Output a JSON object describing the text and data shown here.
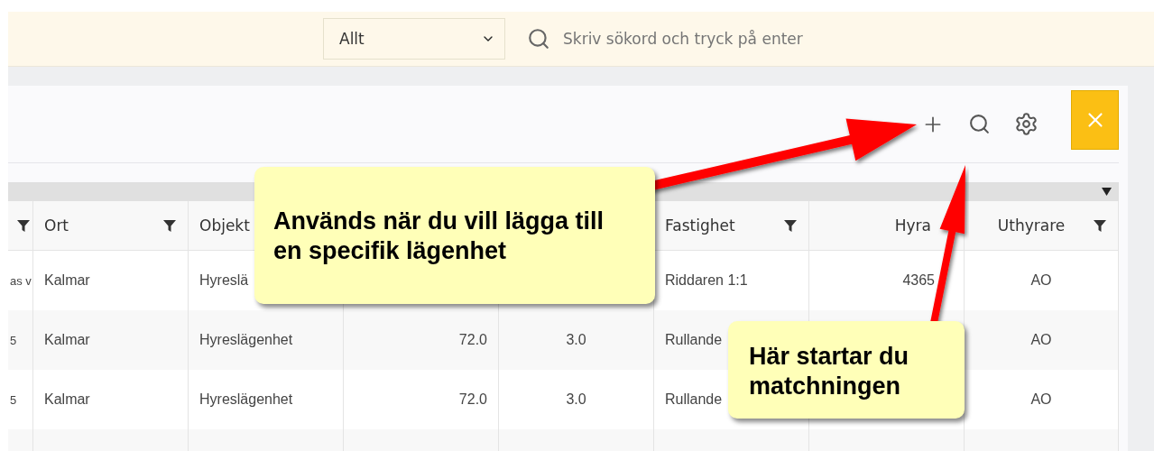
{
  "top_bar": {
    "filter_select": {
      "value": "Allt"
    },
    "search": {
      "placeholder": "Skriv sökord och tryck på enter"
    }
  },
  "table": {
    "columns": [
      {
        "filter": true
      },
      {
        "label": "Ort",
        "filter": true
      },
      {
        "label": "Objekt"
      },
      {},
      {},
      {
        "label": "Fastighet",
        "filter": true
      },
      {
        "label": "Hyra"
      },
      {
        "label": "Uthyrare",
        "filter": true
      }
    ],
    "rows": [
      [
        "as v",
        "Kalmar",
        "Hyreslä",
        null,
        null,
        "Riddaren 1:1",
        "4365",
        "AO"
      ],
      [
        "5",
        "Kalmar",
        "Hyreslägenhet",
        "72.0",
        "3.0",
        "Rullande",
        null,
        "AO"
      ],
      [
        "5",
        "Kalmar",
        "Hyreslägenhet",
        "72.0",
        "3.0",
        "Rullande",
        null,
        "AO"
      ],
      [
        null,
        null,
        null,
        null,
        null,
        null,
        null,
        null
      ]
    ]
  },
  "callouts": [
    {
      "text": "Används när du vill lägga till en specifik lägenhet"
    },
    {
      "text": "Här startar du matchningen"
    }
  ]
}
